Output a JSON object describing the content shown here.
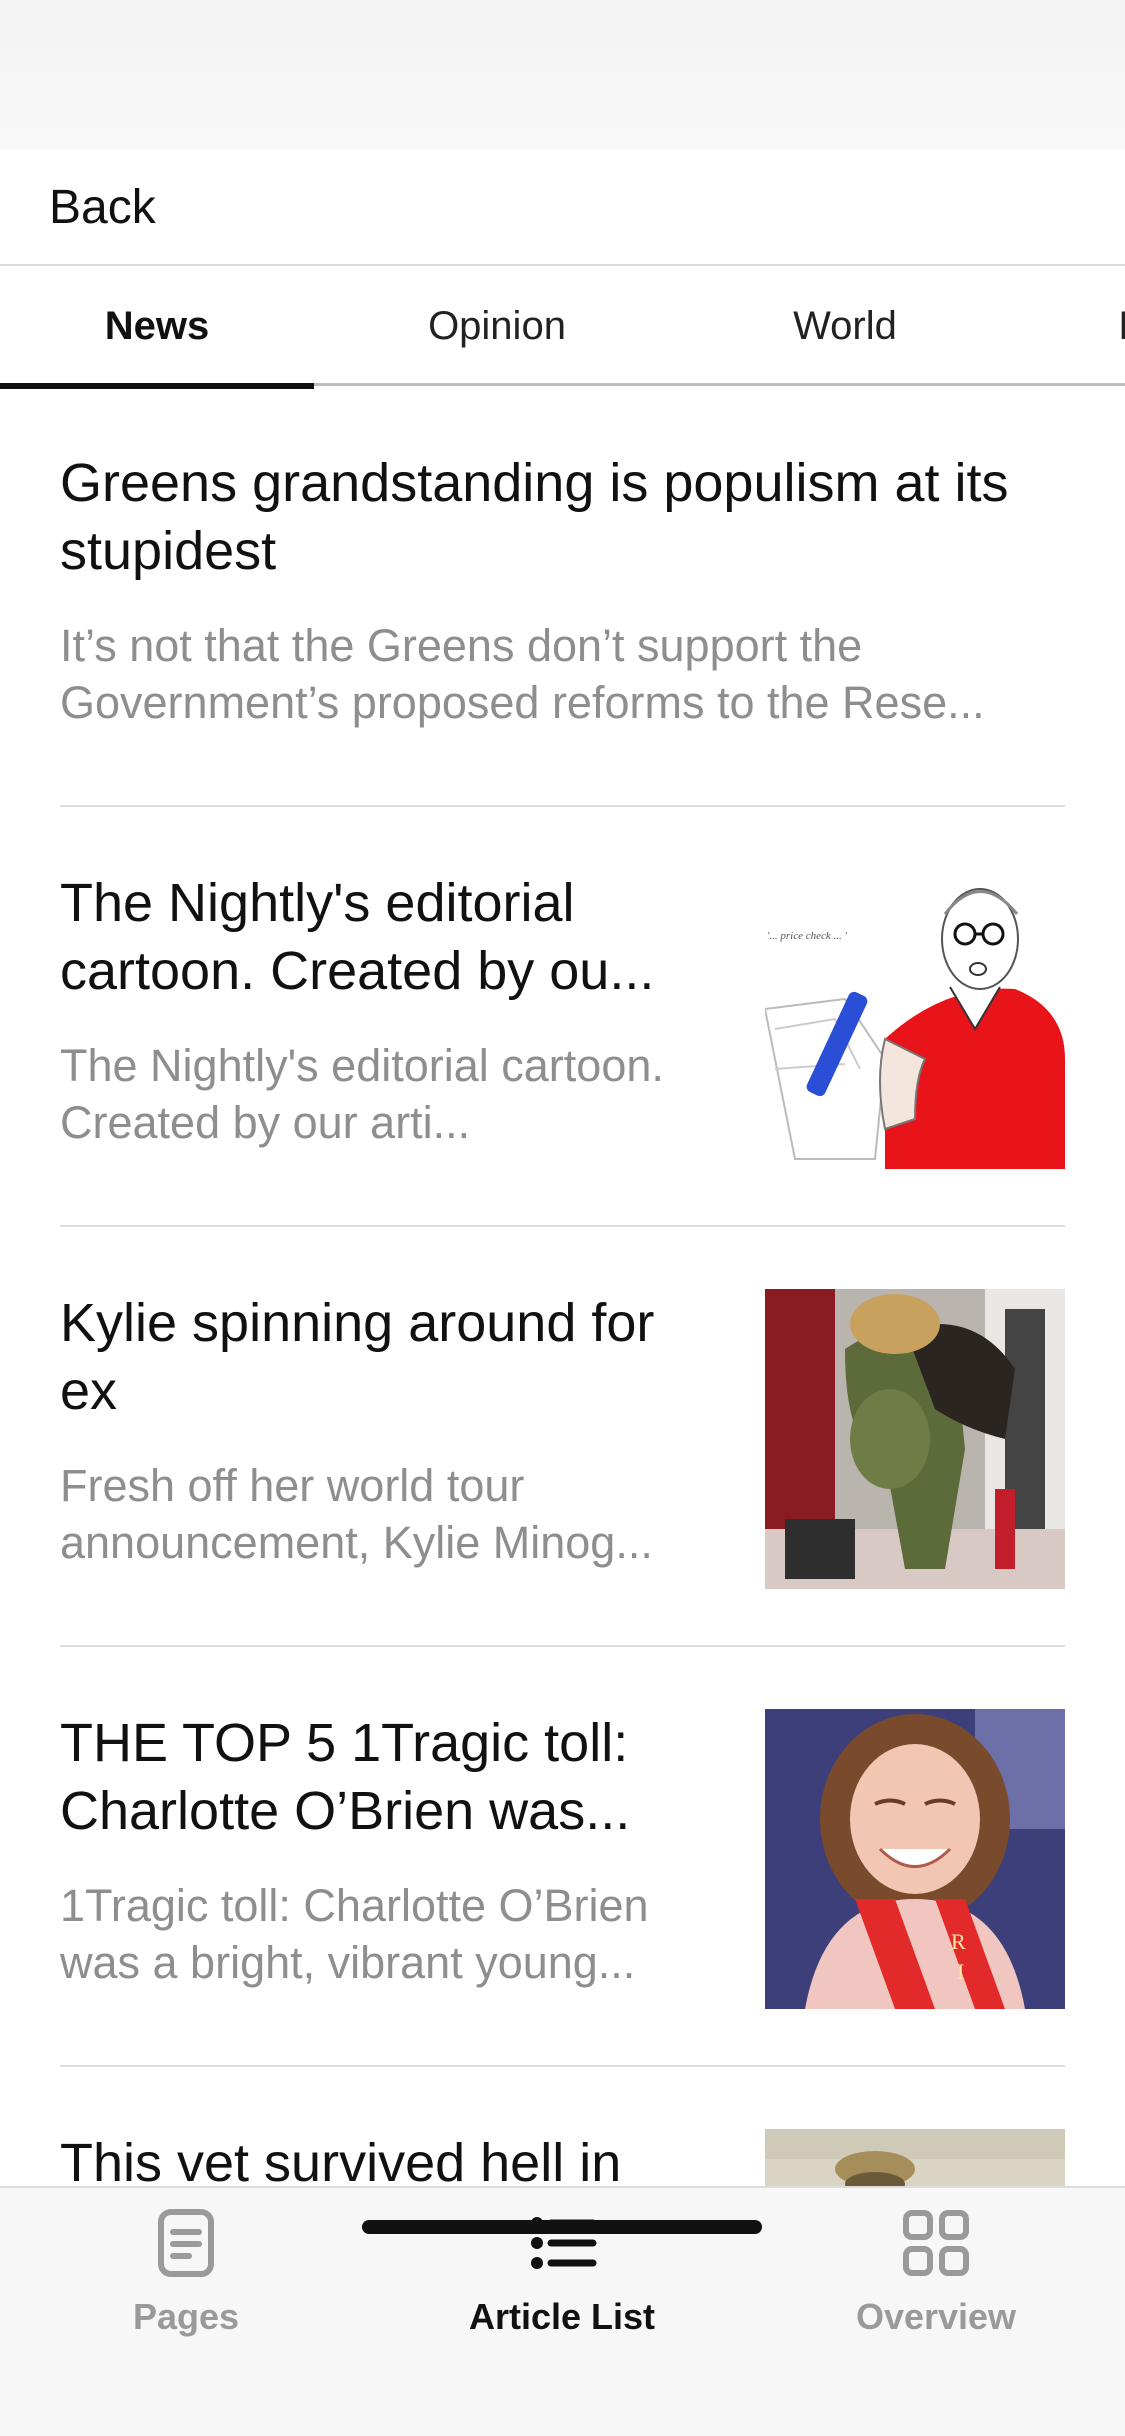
{
  "header": {
    "back_label": "Back"
  },
  "tabs": [
    {
      "label": "News",
      "active": true
    },
    {
      "label": "Opinion",
      "active": false
    },
    {
      "label": "World",
      "active": false
    },
    {
      "label": "I",
      "active": false
    }
  ],
  "articles": [
    {
      "title": "Greens grandstanding is populism at its stupidest",
      "description": "It’s not that the Greens don’t support the Government’s proposed reforms to the Rese..."
    },
    {
      "title": "The Nightly's editorial cartoon. Created by ou...",
      "description": "The Nightly's editorial cartoon. Created by our arti...",
      "thumbnail_caption": "'... price check ... '"
    },
    {
      "title": "Kylie spinning around for ex",
      "description": "Fresh off her world tour announcement, Kylie Minog..."
    },
    {
      "title": "THE TOP 5 1Tragic toll: Charlotte O’Brien was...",
      "description": "1Tragic toll: Charlotte O’Brien was a bright, vibrant young..."
    },
    {
      "title": "This vet survived hell in"
    }
  ],
  "bottom_nav": [
    {
      "label": "Pages",
      "icon": "pages-icon",
      "active": false
    },
    {
      "label": "Article List",
      "icon": "list-icon",
      "active": true
    },
    {
      "label": "Overview",
      "icon": "grid-icon",
      "active": false
    }
  ],
  "colors": {
    "accent": "#111111",
    "muted_text": "#8e8e8e",
    "divider": "#dddddd"
  }
}
